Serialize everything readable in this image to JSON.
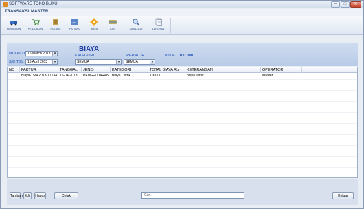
{
  "window": {
    "title": "SOFTWARE TOKO BUKU",
    "min": "–",
    "max": "□",
    "close": "✕"
  },
  "menu": {
    "items": [
      {
        "label": "TRANSAKSI"
      },
      {
        "label": "MASTER"
      }
    ]
  },
  "ribbon": {
    "buttons": [
      {
        "label": "PEMBELIAN",
        "icon": "truck-icon"
      },
      {
        "label": "PENJUALAN",
        "icon": "cart-icon"
      },
      {
        "label": "HUTANG",
        "icon": "ledger-icon"
      },
      {
        "label": "PIUTANG",
        "icon": "receivable-icon"
      },
      {
        "label": "BIAYA",
        "icon": "gear-icon"
      },
      {
        "label": "KAS",
        "icon": "cash-icon"
      },
      {
        "label": "KATALOGS",
        "icon": "search-icon"
      },
      {
        "label": "LAPORAN",
        "icon": "report-icon"
      }
    ]
  },
  "filters": {
    "page_title": "BIAYA",
    "mulai_label": "MULAI TGL",
    "mulai_value": "16 March 2013",
    "sd_label": "S/D TGL",
    "sd_value": "15 April 2013",
    "kategori_label": "KATEGORI",
    "kategori_value": "SEMUA",
    "operator_label": "OPERATOR",
    "operator_value": "SEMUA",
    "total_label": "TOTAL",
    "total_value": "100.000"
  },
  "table": {
    "headers": [
      "NO",
      "FAKTUR",
      "TANGGAL",
      "JENIS",
      "KATEGORI",
      "TOTAL BIAYA Rp.",
      "KETERANGAN",
      "OPERATOR"
    ],
    "rows": [
      [
        "1",
        "Biaya-15042013-171343",
        "15-04-2013",
        "PENGELUARAN",
        "Biaya Listrik",
        "100000",
        "biaya listrik",
        "Master"
      ]
    ]
  },
  "footer": {
    "tambah": "Tambah",
    "edit": "Edit",
    "hapus": "Hapus",
    "cetak": "Cetak",
    "search_placeholder": "Cari..",
    "keluar": "Keluar"
  },
  "colors": {
    "accent_blue": "#1f4fb8",
    "header_band": "#c5d5ec"
  }
}
